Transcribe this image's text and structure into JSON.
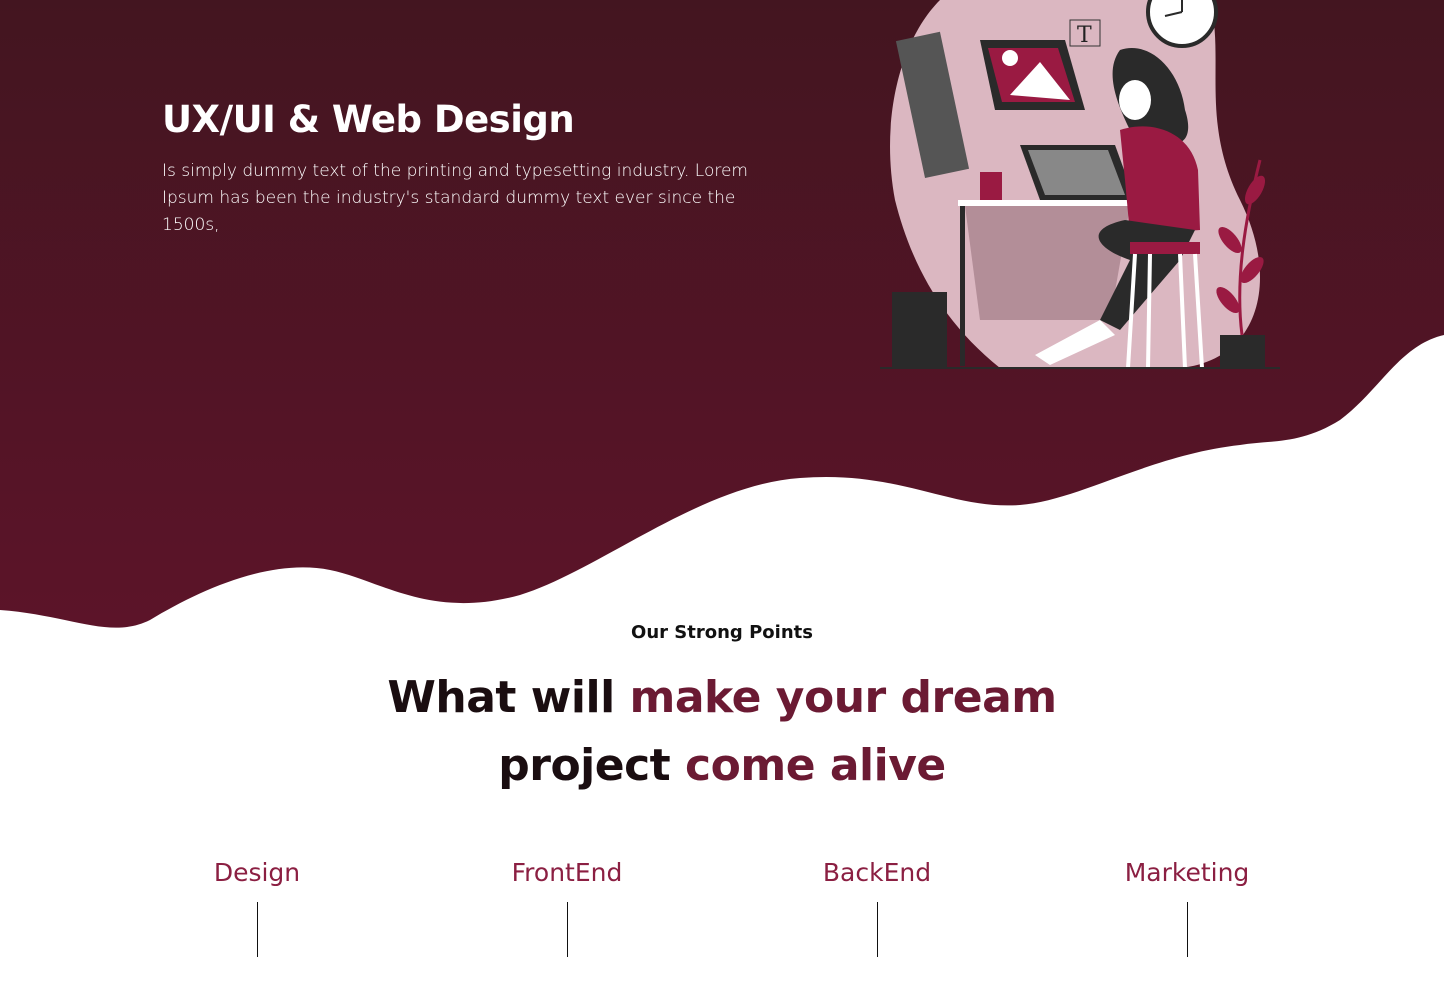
{
  "colors": {
    "hero_top": "#431520",
    "hero_bottom": "#5a1428",
    "accent": "#8b1f42",
    "blob": "#dbb7c1"
  },
  "hero": {
    "title": "UX/UI & Web Design",
    "description": "Is simply dummy text of the printing and typesetting industry. Lorem Ipsum has been the industry's standard dummy text ever since the 1500s,",
    "illustration": "designer-at-drawing-tablet-illustration"
  },
  "section": {
    "eyebrow": "Our Strong Points",
    "headline_part1": "What will ",
    "headline_accent": "make your dream",
    "headline_part2": "project",
    "headline_accent2": " come alive"
  },
  "points": [
    {
      "label": "Design"
    },
    {
      "label": "FrontEnd"
    },
    {
      "label": "BackEnd"
    },
    {
      "label": "Marketing"
    }
  ]
}
